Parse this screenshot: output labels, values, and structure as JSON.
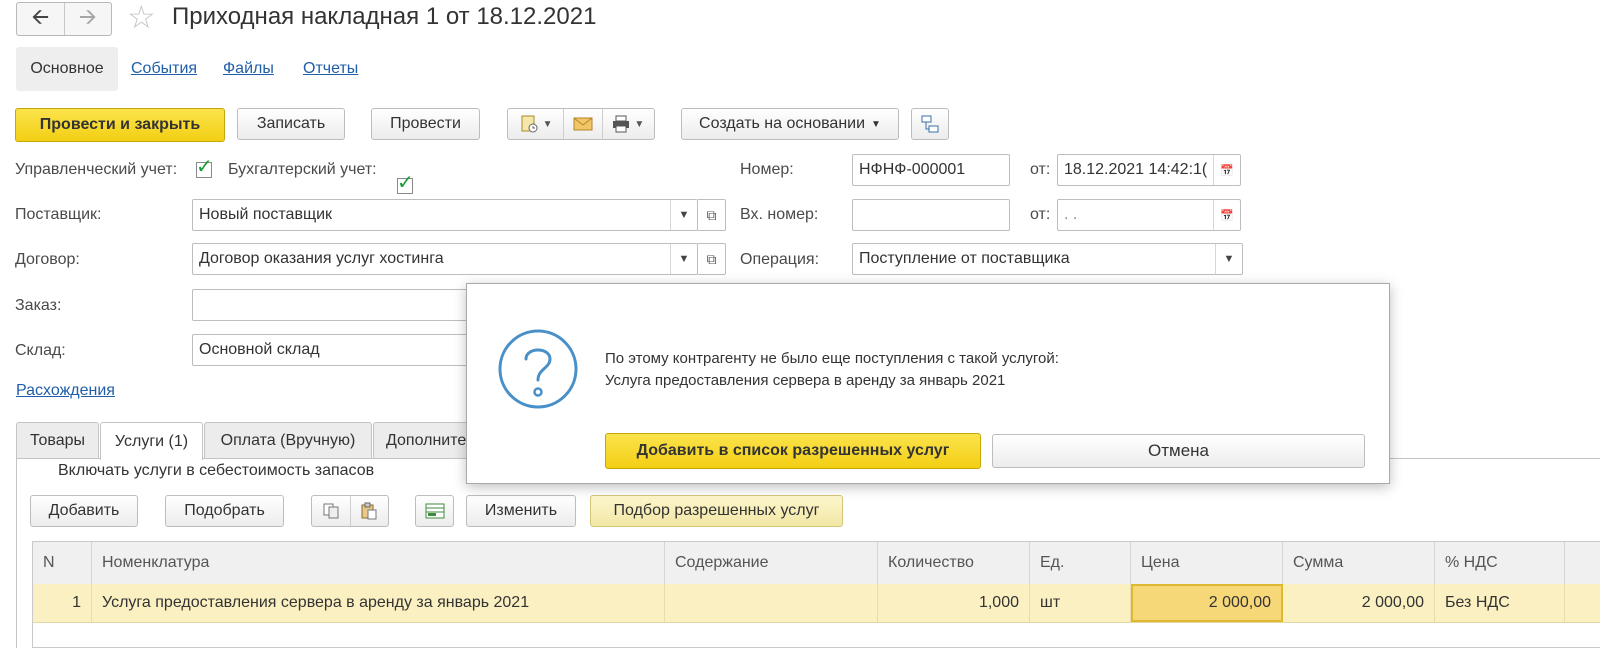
{
  "window": {
    "title": "Приходная накладная 1 от 18.12.2021"
  },
  "nav_tabs": [
    {
      "label": "Основное",
      "active": true
    },
    {
      "label": "События"
    },
    {
      "label": "Файлы"
    },
    {
      "label": "Отчеты"
    }
  ],
  "toolbar": {
    "post_close_label": "Провести и закрыть",
    "save_label": "Записать",
    "post_label": "Провести",
    "create_based_label": "Создать на основании"
  },
  "header_form": {
    "mgmt_accounting_label": "Управленческий учет:",
    "mgmt_accounting_checked": true,
    "fin_accounting_label": "Бухгалтерский учет:",
    "fin_accounting_checked": true,
    "number_label": "Номер:",
    "number_value": "НФНФ-000001",
    "from_label": "от:",
    "date_value": "18.12.2021 14:42:1(",
    "in_number_label": "Вх. номер:",
    "in_number_value": "",
    "in_date_value": " .  .",
    "supplier_label": "Поставщик:",
    "supplier_value": "Новый поставщик",
    "contract_label": "Договор:",
    "contract_value": "Договор оказания услуг хостинга",
    "operation_label": "Операция:",
    "operation_value": "Поступление от поставщика",
    "order_label": "Заказ:",
    "order_value": "",
    "warehouse_label": "Склад:",
    "warehouse_value": "Основной склад",
    "discrepancies_link": "Расхождения"
  },
  "page_tabs": [
    {
      "label": "Товары"
    },
    {
      "label": "Услуги (1)",
      "active": true
    },
    {
      "label": "Оплата (Вручную)"
    },
    {
      "label": "Дополните"
    }
  ],
  "services_tab": {
    "include_cost_label": "Включать услуги в себестоимость запасов",
    "include_cost_checked": false,
    "add_label": "Добавить",
    "pick_label": "Подобрать",
    "change_label": "Изменить",
    "pick_allowed_label": "Подбор разрешенных услуг"
  },
  "table": {
    "columns": [
      "N",
      "Номенклатура",
      "Содержание",
      "Количество",
      "Ед.",
      "Цена",
      "Сумма",
      "% НДС"
    ],
    "rows": [
      {
        "n": "1",
        "item": "Услуга предоставления сервера в аренду за январь 2021",
        "content": "",
        "qty": "1,000",
        "unit": "шт",
        "price": "2 000,00",
        "sum": "2 000,00",
        "vat": "Без НДС"
      }
    ]
  },
  "dialog": {
    "message_line1": "По этому контрагенту не было еще поступления с такой услугой:",
    "message_line2": "Услуга предоставления сервера в аренду за январь 2021",
    "primary_label": "Добавить в список разрешенных услуг",
    "cancel_label": "Отмена"
  },
  "colors": {
    "accent_yellow": "#f3cf14",
    "link_blue": "#1f5ea8",
    "selected_row": "#fbf0c2",
    "check_green": "#1a9b3a",
    "question_icon_blue": "#4a90c8"
  }
}
